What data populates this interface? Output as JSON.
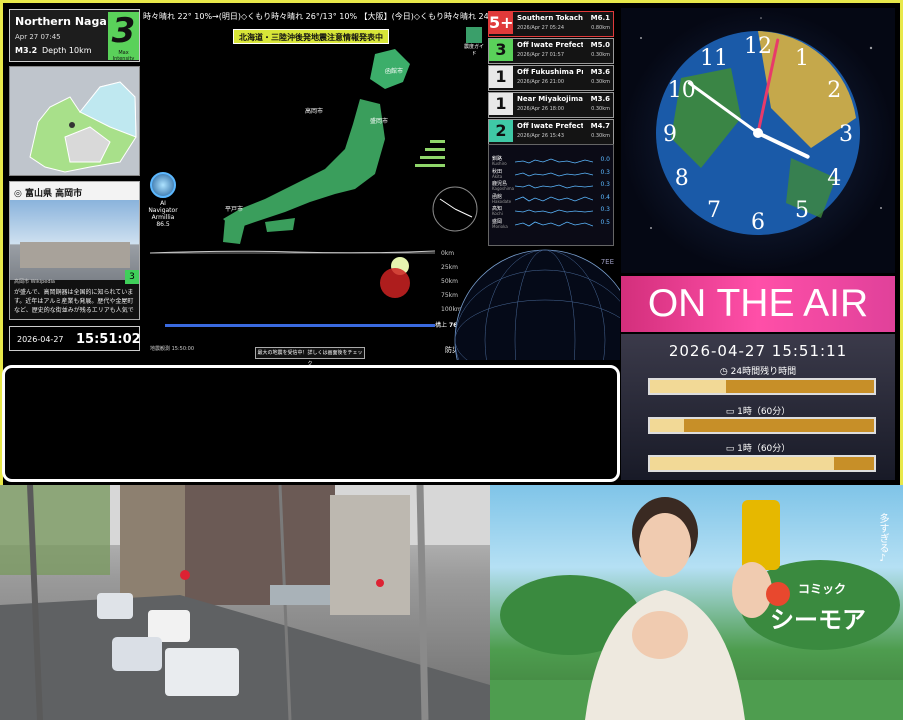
{
  "eq_card": {
    "place": "Northern Naga",
    "date": "Apr 27 07:45",
    "magnitude": "M3.2",
    "depth": "Depth 10km",
    "intensity": "3",
    "intensity_label": "Max Intensity"
  },
  "city_card": {
    "title": "富山県 高岡市",
    "credit": "高岡市 Wikipedia",
    "desc": "が盛んで、高岡銅器は全国的に知られています。近年はアルミ産業も発展。歴代や金屋町など、歴史的な街並みが残るエリアも人気で",
    "badge": "3"
  },
  "local_clock": {
    "date": "2026-04-27",
    "time": "15:51:02"
  },
  "ticker": "時々晴れ 22° 10%→(明日)◇くもり時々晴れ 26°/13° 10% 【大阪】(今日)◇くもり時々晴れ 24° 10%→(明",
  "banner": "北海道・三陸沖後発地震注意情報発表中",
  "guide_label": "震度ガイド",
  "ai_nav": {
    "line1": "AI Navigator",
    "line2": "Armillia 86.5"
  },
  "map_labels": [
    "函館市",
    "盛岡市",
    "高岡市",
    "平戸市"
  ],
  "depth_ticks": [
    "0km",
    "25km",
    "50km",
    "75km",
    "100km"
  ],
  "depth_readout": {
    "label": "構上",
    "value": "76",
    "unit": "km"
  },
  "graph_clock": "地震観測 15:50:00",
  "warn_button": "最大の地震を受信中！詳しくは画面後をチェック",
  "pref_label": "防災科研",
  "eq_list": [
    {
      "intensity": "5+",
      "color": "#e03a3a",
      "name": "Southern Tokachi I",
      "date": "2026/Apr 27 05:24",
      "mag": "M6.1",
      "depth": "0.80km"
    },
    {
      "intensity": "3",
      "color": "#5ad15a",
      "name": "Off Iwate Prefectur",
      "date": "2026/Apr 27 01:57",
      "mag": "M5.0",
      "depth": "0.30km"
    },
    {
      "intensity": "1",
      "color": "#e8e8e8",
      "name": "Off Fukushima Pre",
      "date": "2026/Apr 26 21:00",
      "mag": "M3.6",
      "depth": "0.30km"
    },
    {
      "intensity": "1",
      "color": "#e8e8e8",
      "name": "Near Miyakojima",
      "date": "2026/Apr 26 18:00",
      "mag": "M3.6",
      "depth": "0.30km"
    },
    {
      "intensity": "2",
      "color": "#3fc9a6",
      "name": "Off Iwate Prefectur",
      "date": "2026/Apr 26 15:43",
      "mag": "M4.7",
      "depth": "0.30km"
    }
  ],
  "seismo": [
    {
      "city": "釧路",
      "roman": "Kushiro",
      "value": "0.0"
    },
    {
      "city": "秋田",
      "roman": "Akita",
      "value": "0.3"
    },
    {
      "city": "鹿児島",
      "roman": "Kagoshima",
      "value": "0.3"
    },
    {
      "city": "函館",
      "roman": "Hakodate",
      "value": "0.4"
    },
    {
      "city": "高知",
      "roman": "Kochi",
      "value": "0.3"
    },
    {
      "city": "盛岡",
      "roman": "Morioka",
      "value": "0.5"
    }
  ],
  "globe_label": "7EE",
  "analog_clock": {
    "numbers": [
      "12",
      "1",
      "2",
      "3",
      "4",
      "5",
      "6",
      "7",
      "8",
      "9",
      "10",
      "11"
    ],
    "hour": 3.85,
    "minute": 51,
    "second": 2
  },
  "onair": "ON THE AIR",
  "broadcast": {
    "datetime": "2026-04-27 15:51:11",
    "bars": [
      {
        "label": "24時間残り時間",
        "fill": 0.34
      },
      {
        "label": "1時（60分）",
        "fill": 0.15
      },
      {
        "label": "1時（60分）",
        "fill": 0.82
      }
    ]
  },
  "ad": {
    "logo_small": "コミック",
    "logo_big": "シーモア",
    "tagline": "多すぎる♪"
  },
  "colors": {
    "accent": "#e8e84a",
    "onair": "#ff4fa8",
    "bar": "#c78f28",
    "bar_fill": "#f2d996"
  }
}
